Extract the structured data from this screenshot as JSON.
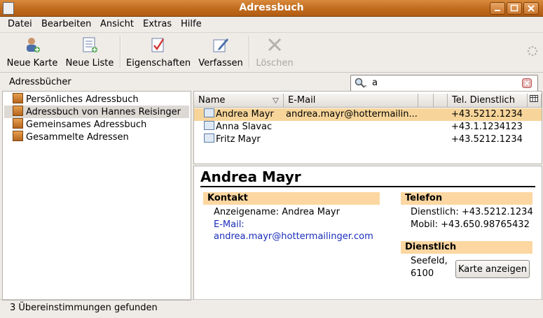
{
  "window": {
    "title": "Adressbuch"
  },
  "menu": [
    "Datei",
    "Bearbeiten",
    "Ansicht",
    "Extras",
    "Hilfe"
  ],
  "toolbar": {
    "new_card": "Neue Karte",
    "new_list": "Neue Liste",
    "properties": "Eigenschaften",
    "compose": "Verfassen",
    "delete": "Löschen"
  },
  "sidebar": {
    "heading": "Adressbücher",
    "items": [
      "Persönliches Adressbuch",
      "Adressbuch von Hannes Reisinger",
      "Gemeinsames Adressbuch",
      "Gesammelte Adressen"
    ]
  },
  "search": {
    "value": "a"
  },
  "table": {
    "headers": {
      "name": "Name",
      "email": "E-Mail",
      "phone": "Tel. Dienstlich"
    },
    "rows": [
      {
        "name": "Andrea Mayr",
        "email": "andrea.mayr@hottermailin...",
        "phone": "+43.5212.1234"
      },
      {
        "name": "Anna Slavac",
        "email": "",
        "phone": "+43.1.1234123"
      },
      {
        "name": "Fritz Mayr",
        "email": "",
        "phone": "+43.5212.1234"
      }
    ]
  },
  "detail": {
    "name": "Andrea Mayr",
    "contact_heading": "Kontakt",
    "display_name": "Anzeigename: Andrea Mayr",
    "email_label": "E-Mail:",
    "email": "andrea.mayr@hottermailinger.com",
    "phone_heading": "Telefon",
    "phone_work": "Dienstlich: +43.5212.1234",
    "phone_mobile": "Mobil: +43.650.98765432",
    "work_heading": "Dienstlich",
    "city": "Seefeld,",
    "zip": "6100",
    "map_button": "Karte anzeigen"
  },
  "status": "3 Übereinstimmungen gefunden"
}
